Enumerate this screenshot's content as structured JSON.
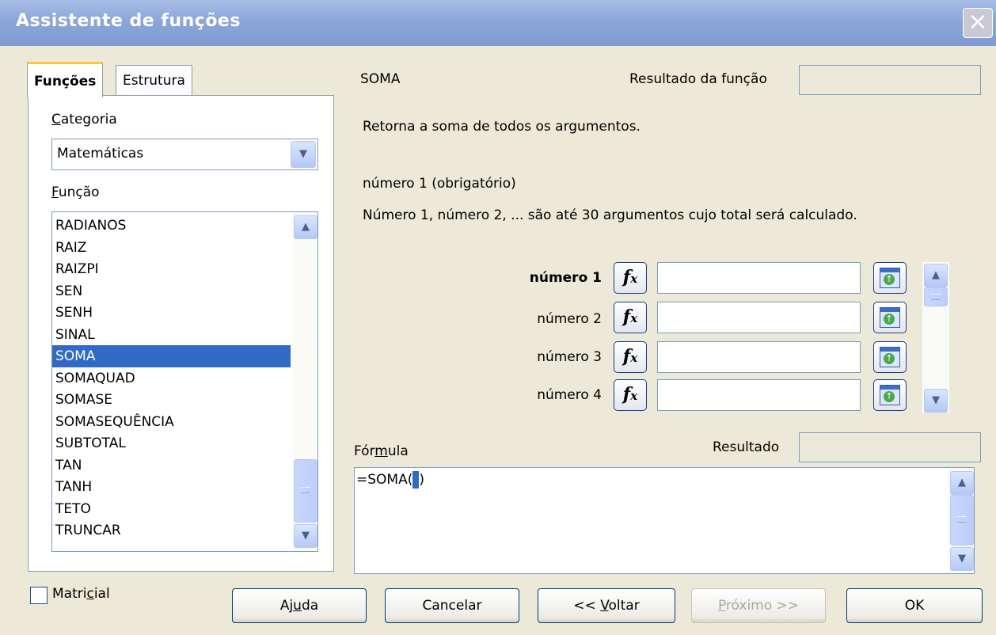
{
  "window": {
    "title": "Assistente de funções",
    "close_label": "×"
  },
  "tabs": [
    {
      "label": "Funções"
    },
    {
      "label": "Estrutura"
    }
  ],
  "category": {
    "label": "Categoria",
    "value": "Matemáticas"
  },
  "function_list": {
    "label": "Função",
    "items": [
      "RADIANOS",
      "RAIZ",
      "RAIZPI",
      "SEN",
      "SENH",
      "SINAL",
      "SOMA",
      "SOMAQUAD",
      "SOMASE",
      "SOMASEQUÊNCIA",
      "SUBTOTAL",
      "TAN",
      "TANH",
      "TETO",
      "TRUNCAR"
    ],
    "selected": "SOMA"
  },
  "function": {
    "name": "SOMA",
    "result_label": "Resultado da função",
    "description": "Retorna a soma de todos os argumentos.",
    "arg_title": "número 1 (obrigatório)",
    "arg_description": "Número 1, número 2, ... são até 30 argumentos cujo total será calculado."
  },
  "arguments": [
    {
      "label": "número 1",
      "value": ""
    },
    {
      "label": "número 2",
      "value": ""
    },
    {
      "label": "número 3",
      "value": ""
    },
    {
      "label": "número 4",
      "value": ""
    }
  ],
  "fx_label": "fx",
  "formula": {
    "label": "Fórmula",
    "result_label": "Resultado",
    "value": "=SOMA()"
  },
  "matricial_label": "Matricial",
  "buttons": {
    "help": "Ajuda",
    "cancel": "Cancelar",
    "back": "<< Voltar",
    "next": "Próximo >>",
    "ok": "OK"
  },
  "icons": {
    "chevron_down": "▼",
    "chevron_up": "▲"
  }
}
